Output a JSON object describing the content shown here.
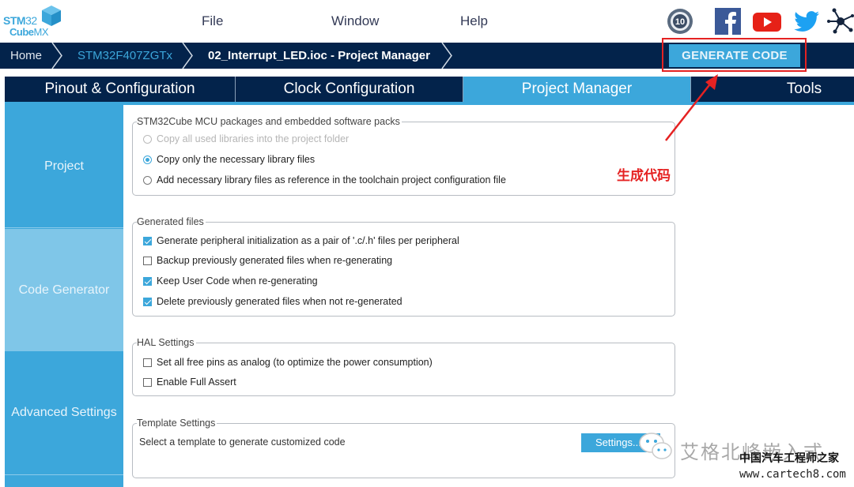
{
  "app": {
    "logo_line1_bold": "STM",
    "logo_line1_light": "32",
    "logo_line2_bold": "Cube",
    "logo_line2_light": "MX"
  },
  "menu": {
    "items": [
      {
        "label": "File"
      },
      {
        "label": "Window"
      },
      {
        "label": "Help"
      }
    ]
  },
  "social_icons": [
    "anniversary-10-badge-icon",
    "facebook-icon",
    "youtube-icon",
    "twitter-icon",
    "network-icon"
  ],
  "breadcrumb": {
    "items": [
      {
        "label": "Home"
      },
      {
        "label": "STM32F407ZGTx"
      },
      {
        "label": "02_Interrupt_LED.ioc - Project Manager"
      }
    ]
  },
  "toolbar": {
    "generate_label": "GENERATE CODE"
  },
  "tabs": [
    {
      "label": "Pinout & Configuration",
      "active": false
    },
    {
      "label": "Clock Configuration",
      "active": false
    },
    {
      "label": "Project Manager",
      "active": true
    },
    {
      "label": "Tools",
      "active": false
    }
  ],
  "sidebar": {
    "items": [
      {
        "label": "Project",
        "selected": false
      },
      {
        "label": "Code Generator",
        "selected": true
      },
      {
        "label": "Advanced Settings",
        "selected": false
      }
    ]
  },
  "groups": {
    "packages": {
      "title": "STM32Cube MCU packages and embedded software packs",
      "options": [
        {
          "label": "Copy all used libraries into the project folder",
          "selected": false,
          "disabled": true
        },
        {
          "label": "Copy only the necessary library files",
          "selected": true,
          "disabled": false
        },
        {
          "label": "Add necessary library files as reference in the toolchain project configuration file",
          "selected": false,
          "disabled": false
        }
      ]
    },
    "generated_files": {
      "title": "Generated files",
      "options": [
        {
          "label": "Generate peripheral initialization as a pair of '.c/.h' files per peripheral",
          "checked": true
        },
        {
          "label": "Backup previously generated files when re-generating",
          "checked": false
        },
        {
          "label": "Keep User Code when re-generating",
          "checked": true
        },
        {
          "label": "Delete previously generated files when not re-generated",
          "checked": true
        }
      ]
    },
    "hal_settings": {
      "title": "HAL Settings",
      "options": [
        {
          "label": "Set all free pins as analog (to optimize the power consumption)",
          "checked": false
        },
        {
          "label": "Enable Full Assert",
          "checked": false
        }
      ]
    },
    "template_settings": {
      "title": "Template Settings",
      "description": "Select a template to generate customized code",
      "button_label": "Settings..."
    }
  },
  "annotation": {
    "label": "生成代码",
    "color": "#e52222"
  },
  "watermark": {
    "line1": "艾格北峰嵌入式",
    "line2": "中国汽车工程师之家",
    "line3": "www.cartech8.com"
  },
  "colors": {
    "accent": "#3ca7db",
    "navy": "#03234b",
    "sidebar_selected": "#7fc6e8",
    "annotation_red": "#e52222"
  }
}
